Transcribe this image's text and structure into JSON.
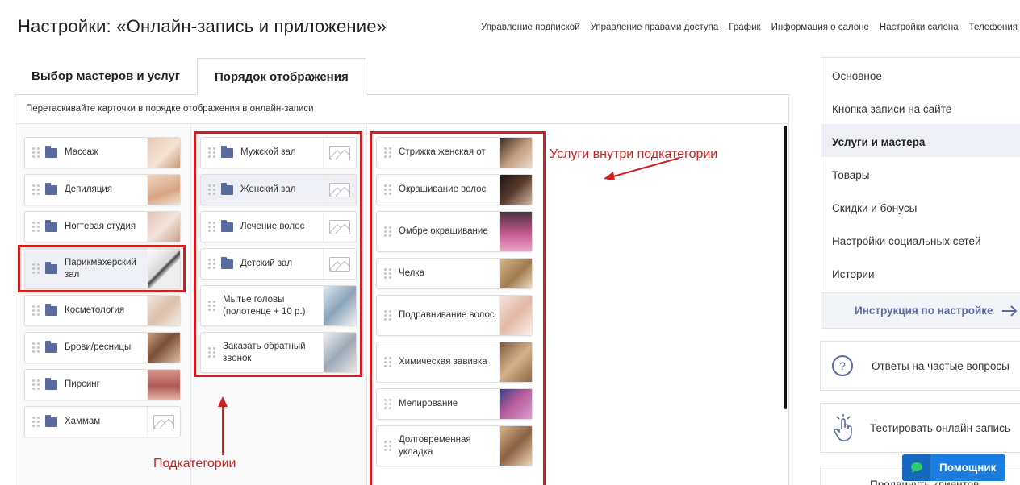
{
  "header": {
    "title": "Настройки: «Онлайн-запись и приложение»",
    "links": [
      "Управление подпиской",
      "Управление правами доступа",
      "График",
      "Информация о салоне",
      "Настройки салона",
      "Телефония"
    ]
  },
  "tabs": [
    {
      "label": "Выбор мастеров и услуг",
      "active": false
    },
    {
      "label": "Порядок отображения",
      "active": true
    }
  ],
  "hint": "Перетаскивайте карточки в порядке отображения в онлайн-записи",
  "categories": [
    {
      "label": "Массаж",
      "thumb": "massage-photo"
    },
    {
      "label": "Депиляция",
      "thumb": "depilation-photo"
    },
    {
      "label": "Ногтевая студия",
      "thumb": "nails-photo"
    },
    {
      "label": "Парикмахерский зал",
      "thumb": "scissors-photo",
      "highlighted": true
    },
    {
      "label": "Косметология",
      "thumb": "cosmetology-photo"
    },
    {
      "label": "Брови/ресницы",
      "thumb": "brows-photo"
    },
    {
      "label": "Пирсинг",
      "thumb": "piercing-photo"
    },
    {
      "label": "Хаммам",
      "thumb": "image-placeholder-icon"
    }
  ],
  "subcategories": [
    {
      "label": "Мужской зал",
      "thumb": "image-placeholder-icon"
    },
    {
      "label": "Женский зал",
      "thumb": "image-placeholder-icon",
      "highlighted": true
    },
    {
      "label": "Лечение волос",
      "thumb": "image-placeholder-icon"
    },
    {
      "label": "Детский зал",
      "thumb": "image-placeholder-icon"
    },
    {
      "label": "Мытье головы (полотенце + 10 р.)",
      "thumb": "hair-wash-photo"
    },
    {
      "label": "Заказать обратный звонок",
      "thumb": "callback-photo"
    }
  ],
  "services": [
    {
      "label": "Стрижка женская от",
      "thumb": "haircut-photo"
    },
    {
      "label": "Окрашивание волос",
      "thumb": "coloring-photo"
    },
    {
      "label": "Омбре окрашивание",
      "thumb": "ombre-photo"
    },
    {
      "label": "Челка",
      "thumb": "bangs-photo"
    },
    {
      "label": "Подравнивание волос",
      "thumb": "trim-photo"
    },
    {
      "label": "Химическая завивка",
      "thumb": "perm-photo"
    },
    {
      "label": "Мелирование",
      "thumb": "highlights-photo"
    },
    {
      "label": "Долговременная укладка",
      "thumb": "styling-photo"
    }
  ],
  "annotations": {
    "services_label": "Услуги внутри подкатегории",
    "subcategories_label": "Подкатегории"
  },
  "sidebar": {
    "items": [
      {
        "label": "Основное",
        "active": false
      },
      {
        "label": "Кнопка записи на сайте",
        "active": false
      },
      {
        "label": "Услуги и мастера",
        "active": true
      },
      {
        "label": "Товары",
        "active": false
      },
      {
        "label": "Скидки и бонусы",
        "active": false
      },
      {
        "label": "Настройки социальных сетей",
        "active": false
      },
      {
        "label": "Истории",
        "active": false
      }
    ],
    "instruction": "Инструкция по настройке",
    "faq": "Ответы на частые вопросы",
    "test": "Тестировать онлайн-запись",
    "promote": "Продвинуть клиентов"
  },
  "help_button": "Помощник",
  "colors": {
    "accent": "#5a6b9e",
    "annotation": "#d01f1f",
    "help": "#1a7de0"
  }
}
